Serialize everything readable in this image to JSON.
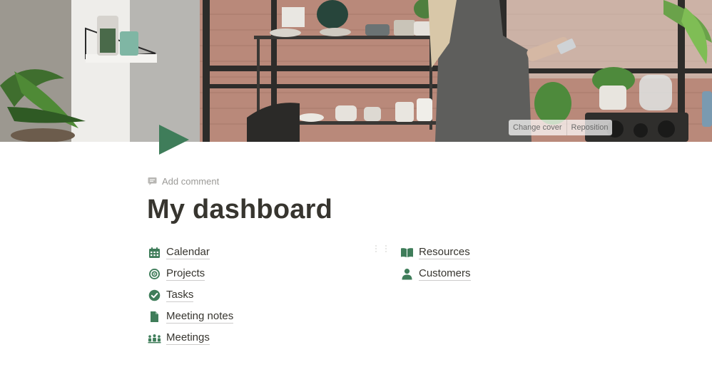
{
  "cover": {
    "change_cover_label": "Change cover",
    "reposition_label": "Reposition"
  },
  "page_icon": "play-triangle-icon",
  "comment": {
    "add_label": "Add comment"
  },
  "title": "My dashboard",
  "links_left": [
    {
      "label": "Calendar",
      "icon": "calendar-icon"
    },
    {
      "label": "Projects",
      "icon": "target-icon"
    },
    {
      "label": "Tasks",
      "icon": "check-circle-icon"
    },
    {
      "label": "Meeting notes",
      "icon": "document-icon"
    },
    {
      "label": "Meetings",
      "icon": "people-group-icon"
    }
  ],
  "links_right": [
    {
      "label": "Resources",
      "icon": "open-book-icon"
    },
    {
      "label": "Customers",
      "icon": "person-icon"
    }
  ],
  "colors": {
    "accent": "#3f7d5a",
    "text": "#37352f",
    "muted": "#9b9a97"
  }
}
